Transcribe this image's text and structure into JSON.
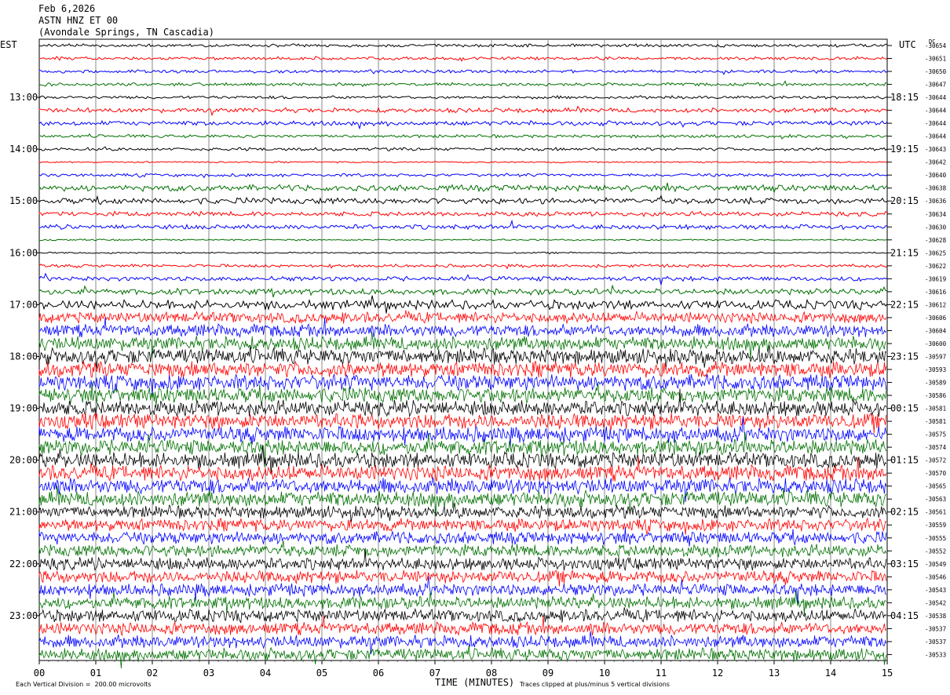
{
  "header": {
    "date": "Feb 6,2026",
    "station": "ASTN HNZ ET 00",
    "location": "(Avondale Springs, TN Cascadia)"
  },
  "left_zone": "EST",
  "right_zone": "UTC",
  "dc_label": "DC",
  "footer": {
    "scale_note": "Each Vertical Division =  200.00 microvolts",
    "clip_note": "Traces clipped at plus/minus 5 vertical divisions",
    "x_axis_title": "TIME (MINUTES)"
  },
  "colors": {
    "trace_cycle": [
      "#000000",
      "#ff0000",
      "#0000ff",
      "#007000"
    ],
    "grid": "#888888"
  },
  "chart_data": {
    "type": "seismogram",
    "xlabel": "TIME (MINUTES)",
    "xlim": [
      0,
      15
    ],
    "x_ticks": [
      "00",
      "01",
      "02",
      "03",
      "04",
      "05",
      "06",
      "07",
      "08",
      "09",
      "10",
      "11",
      "12",
      "13",
      "14",
      "15"
    ],
    "row_minutes": 15,
    "est_hour_labels": [
      "13:00",
      "14:00",
      "15:00",
      "16:00",
      "17:00",
      "18:00",
      "19:00",
      "20:00",
      "21:00",
      "22:00",
      "23:00"
    ],
    "utc_hour_labels": [
      "18:15",
      "19:15",
      "20:15",
      "21:15",
      "22:15",
      "23:15",
      "00:15",
      "01:15",
      "02:15",
      "03:15",
      "04:15"
    ],
    "dc_offsets": [
      "-30654",
      "-30651",
      "-30650",
      "-30647",
      "-30644",
      "-30644",
      "-30644",
      "-30644",
      "-30643",
      "-30642",
      "-30640",
      "-30638",
      "-30636",
      "-30634",
      "-30630",
      "-30628",
      "-30625",
      "-30622",
      "-30619",
      "-30616",
      "-30612",
      "-30606",
      "-30604",
      "-30600",
      "-30597",
      "-30593",
      "-30589",
      "-30586",
      "-30581",
      "-30581",
      "-30575",
      "-30574",
      "-30572",
      "-30570",
      "-30565",
      "-30563",
      "-30561",
      "-30559",
      "-30555",
      "-30552",
      "-30549",
      "-30546",
      "-30543",
      "-30542",
      "-30538",
      "-30537",
      "-30537",
      "-30533"
    ],
    "noise_amplitude": [
      1,
      1,
      1,
      1,
      1,
      1.5,
      1.5,
      1,
      1,
      0.5,
      1,
      2,
      2,
      1.5,
      1.5,
      0.5,
      0.5,
      1,
      1.5,
      2,
      3,
      3.5,
      4,
      4.5,
      5,
      5,
      5,
      5,
      5,
      5,
      5,
      5,
      5,
      5,
      5,
      5,
      4,
      4,
      4,
      4,
      4,
      4,
      4,
      4,
      4,
      4,
      4,
      4
    ]
  }
}
